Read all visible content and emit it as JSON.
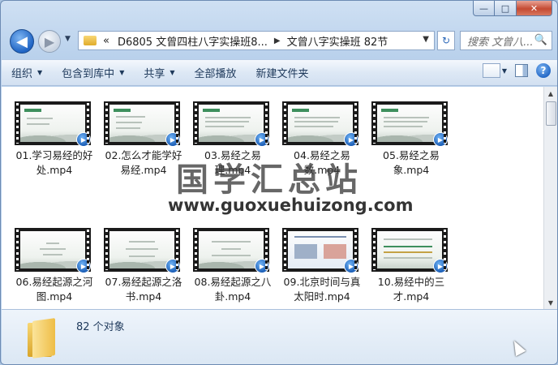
{
  "window": {
    "caption": {
      "minimize": "—",
      "maximize": "□",
      "close": "✕"
    }
  },
  "nav": {
    "back_icon": "◀",
    "forward_icon": "▶",
    "dropdown": "▼",
    "breadcrumb_overflow": "«",
    "breadcrumb": [
      "D6805 文曾四柱八字实操班8...",
      "文曾八字实操班 82节"
    ],
    "breadcrumb_sep": "▶",
    "refresh_icon": "↻",
    "search_placeholder": "搜索 文曾八...",
    "search_icon": "🔍"
  },
  "toolbar": {
    "items": [
      "组织",
      "包含到库中",
      "共享",
      "全部播放",
      "新建文件夹"
    ],
    "arrow": "▼",
    "help": "?"
  },
  "files": [
    {
      "name": "01.学习易经的好处.mp4"
    },
    {
      "name": "02.怎么才能学好易经.mp4"
    },
    {
      "name": "03.易经之易理.mp4"
    },
    {
      "name": "04.易经之易数.mp4"
    },
    {
      "name": "05.易经之易象.mp4"
    },
    {
      "name": "06.易经起源之河图.mp4"
    },
    {
      "name": "07.易经起源之洛书.mp4"
    },
    {
      "name": "08.易经起源之八卦.mp4"
    },
    {
      "name": "09.北京时间与真太阳时.mp4"
    },
    {
      "name": "10.易经中的三才.mp4"
    }
  ],
  "play_icon": "▶",
  "watermark": {
    "cn": "国学汇总站",
    "url": "www.guoxuehuizong.com"
  },
  "scrollbar": {
    "up": "▲",
    "down": "▼"
  },
  "status": {
    "count": "82 个对象"
  }
}
